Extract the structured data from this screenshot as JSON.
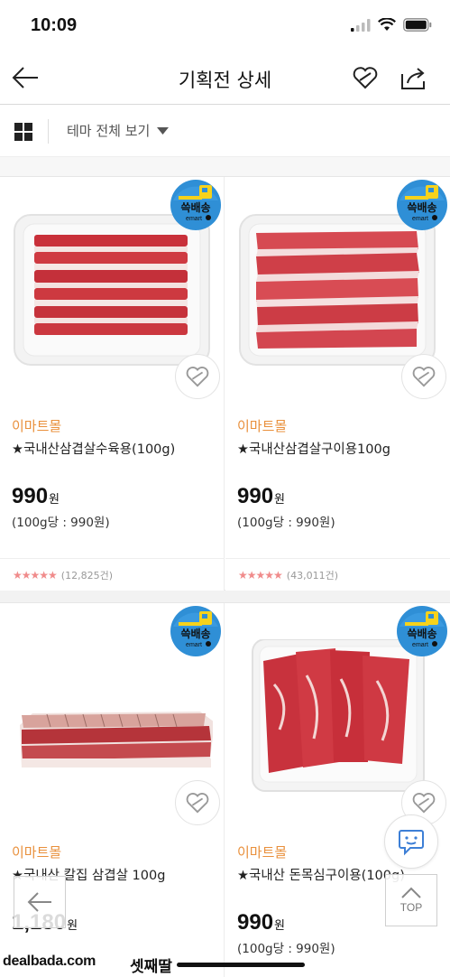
{
  "status_bar": {
    "time": "10:09"
  },
  "nav": {
    "title": "기획전 상세"
  },
  "filter": {
    "theme_label": "테마 전체 보기"
  },
  "badge": {
    "top_text": "쓱배송",
    "bottom_text": "emart"
  },
  "products": [
    {
      "seller": "이마트몰",
      "name": "★국내산삼겹살수육용(100g)",
      "price": "990",
      "price_unit": "원",
      "unit_price": "(100g당 : 990원)",
      "stars": "★★★★★",
      "reviews": "(12,825건)"
    },
    {
      "seller": "이마트몰",
      "name": "★국내산삼겹살구이용100g",
      "price": "990",
      "price_unit": "원",
      "unit_price": "(100g당 : 990원)",
      "stars": "★★★★★",
      "reviews": "(43,011건)"
    },
    {
      "seller": "이마트몰",
      "name": "★국내산 칼집 삼겹살 100g",
      "price": "1,180",
      "price_unit": "원",
      "unit_price": ""
    },
    {
      "seller": "이마트몰",
      "name": "★국내산 돈목심구이용(100g)",
      "price": "990",
      "price_unit": "원",
      "unit_price": "(100g당 : 990원)"
    }
  ],
  "floating": {
    "top_label": "TOP"
  },
  "watermark": {
    "site": "dealbada.com",
    "user": "셋째딸"
  },
  "colors": {
    "seller": "#e9903c",
    "stars": "#f08b8b",
    "badge": "#2f8fd6",
    "badge_yellow": "#f6d21c",
    "meat": "#c9303a"
  }
}
